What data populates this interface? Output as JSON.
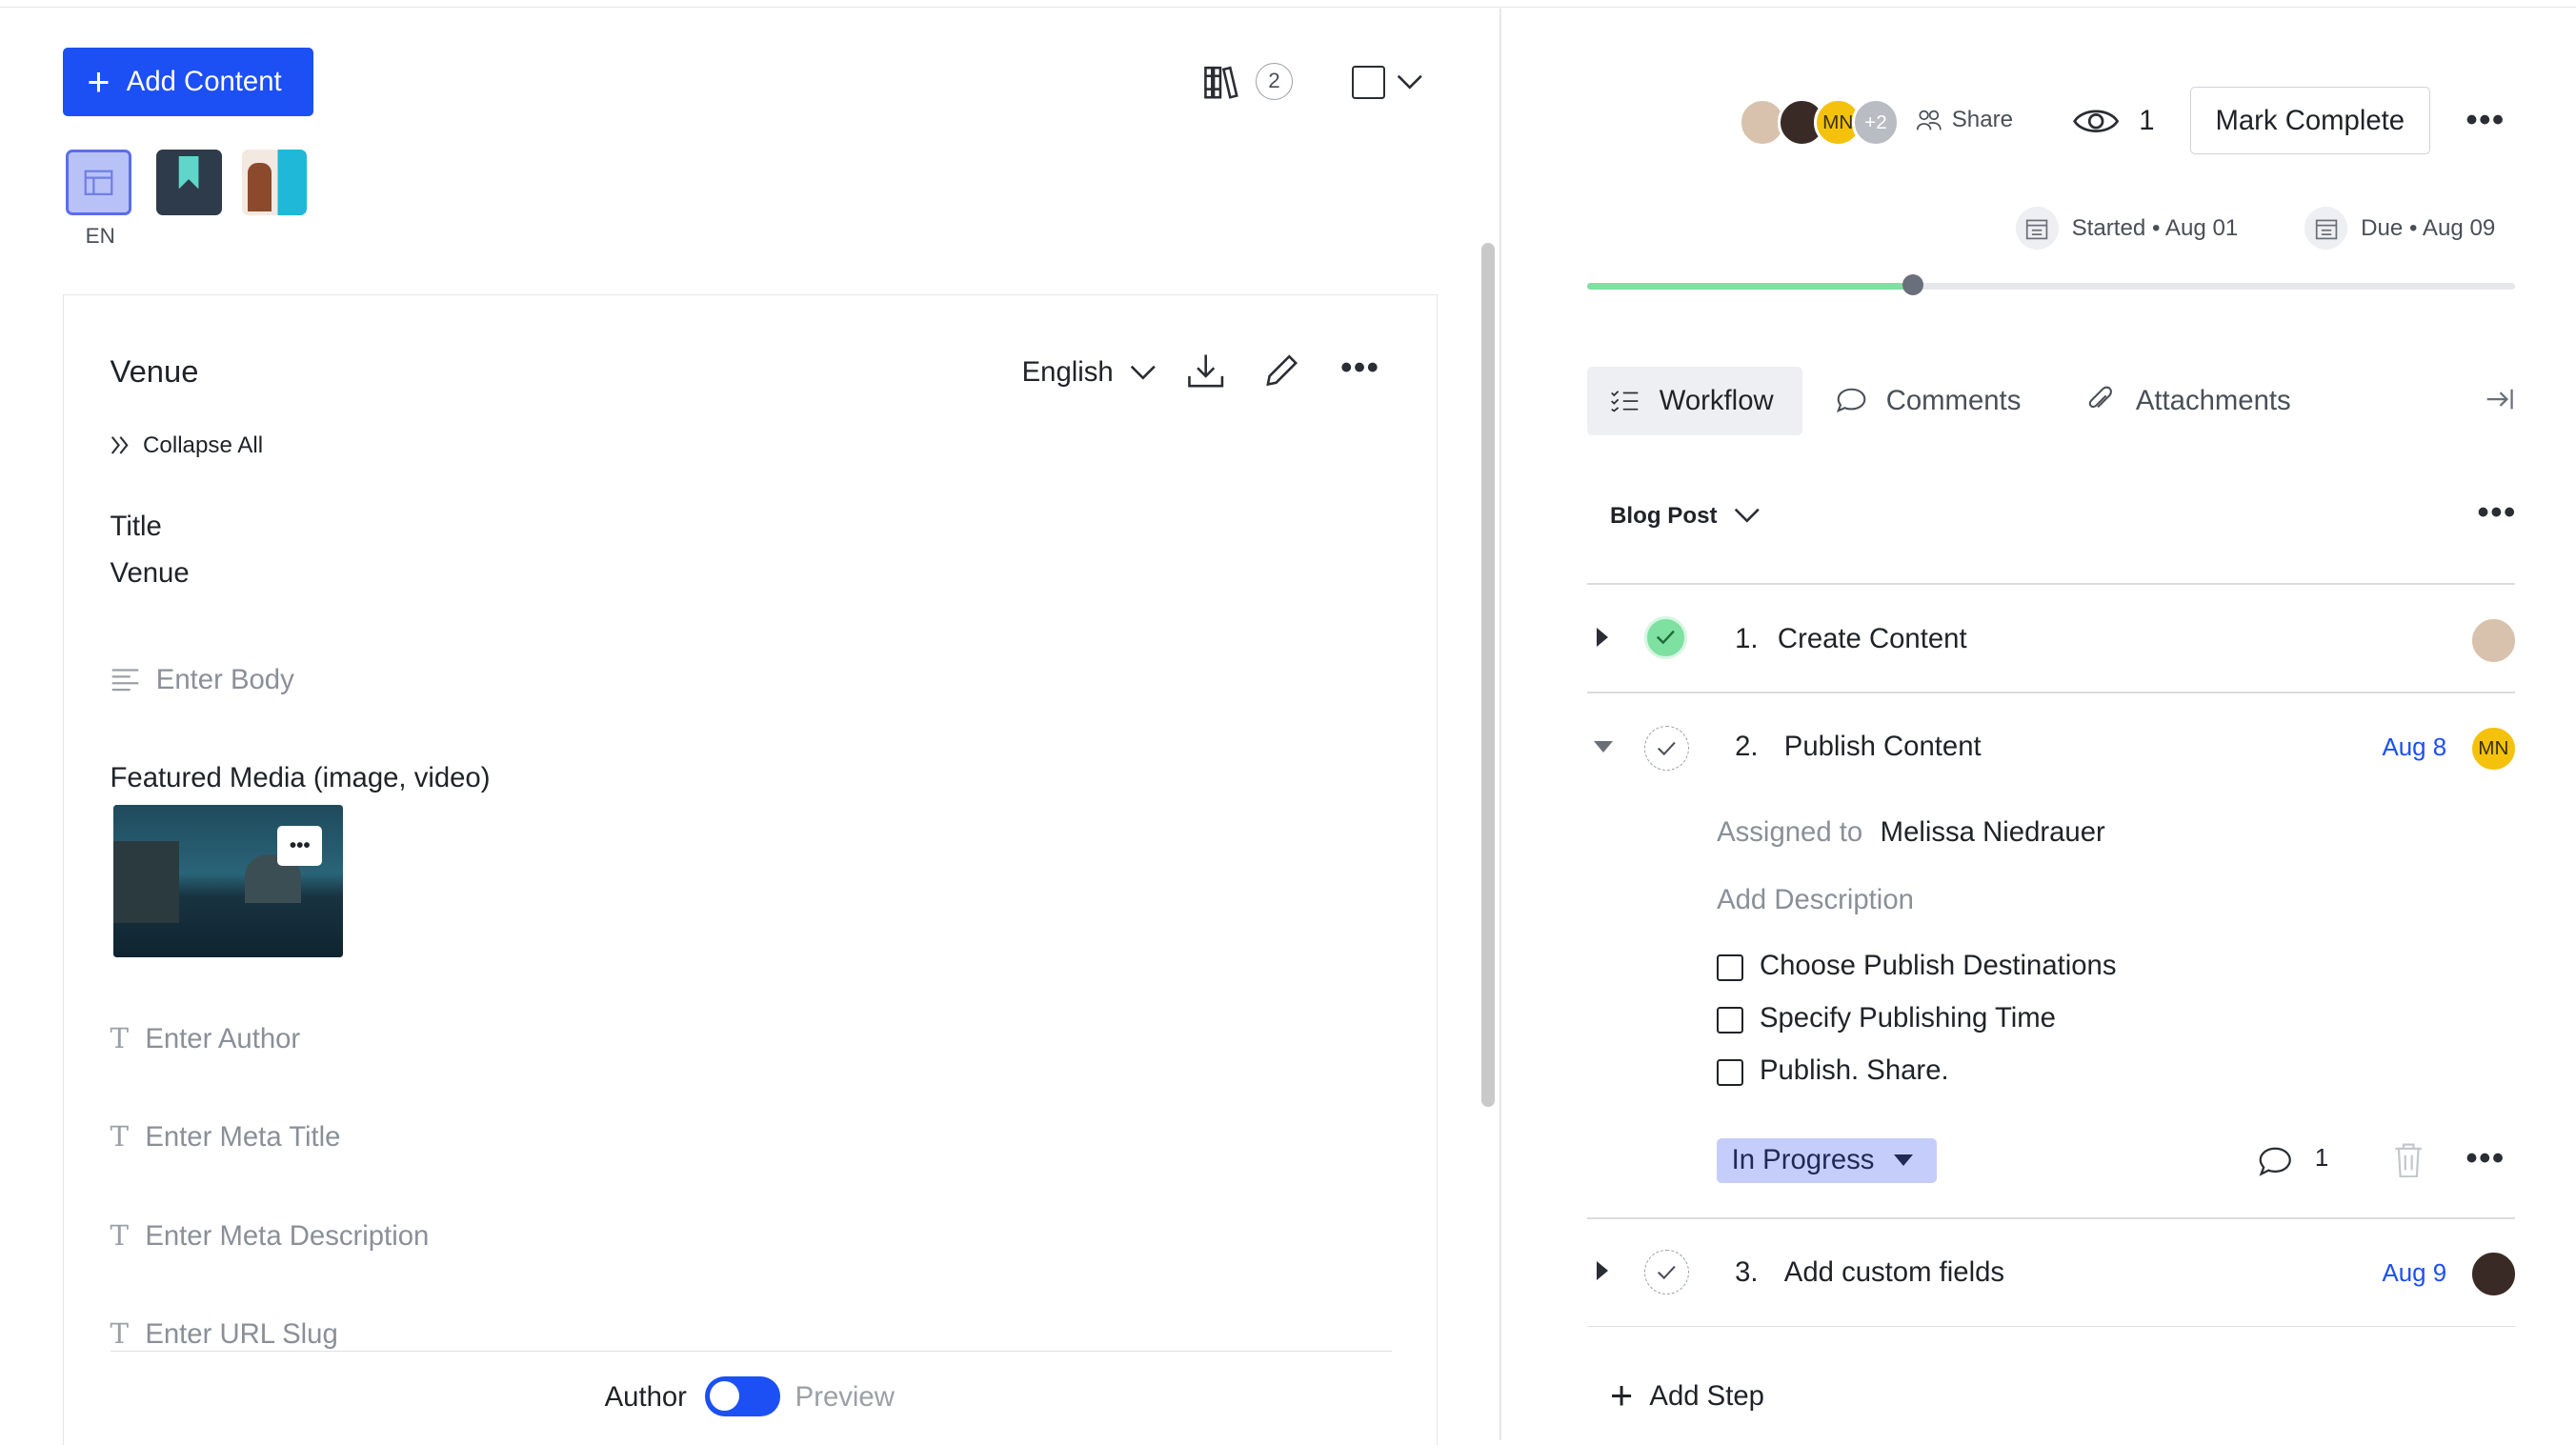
{
  "left": {
    "add_content": "Add Content",
    "library_count": "2",
    "locale": "EN",
    "card": {
      "title": "Venue",
      "language": "English",
      "collapse_all": "Collapse All",
      "field_title_label": "Title",
      "field_title_value": "Venue",
      "body_placeholder": "Enter Body",
      "featured_media_label": "Featured Media (image, video)",
      "author_placeholder": "Enter Author",
      "meta_title_placeholder": "Enter Meta Title",
      "meta_description_placeholder": "Enter Meta Description",
      "url_slug_placeholder": "Enter URL Slug"
    },
    "footer": {
      "author_label": "Author",
      "preview_label": "Preview",
      "toggle_state": "Author"
    }
  },
  "right": {
    "avatars": {
      "initials": "MN",
      "more": "+2"
    },
    "share": "Share",
    "view_count": "1",
    "mark_complete": "Mark Complete",
    "started": "Started • Aug 01",
    "due": "Due • Aug 09",
    "progress": 0.35,
    "tabs": {
      "workflow": "Workflow",
      "comments": "Comments",
      "attachments": "Attachments"
    },
    "template": "Blog Post",
    "steps": [
      {
        "num": "1.",
        "title": "Create Content",
        "date": "",
        "done": true
      },
      {
        "num": "2.",
        "title": "Publish Content",
        "date": "Aug 8",
        "assignee_initials": "MN",
        "done": false
      },
      {
        "num": "3.",
        "title": "Add custom fields",
        "date": "Aug 9",
        "done": false
      }
    ],
    "step2": {
      "assigned_label": "Assigned to",
      "assignee": "Melissa Niedrauer",
      "add_description": "Add Description",
      "checklist": [
        "Choose Publish Destinations",
        "Specify Publishing Time",
        "Publish. Share."
      ],
      "status": "In Progress",
      "comment_count": "1"
    },
    "add_step": "Add Step"
  },
  "colors": {
    "accent": "#1c4ff4",
    "progress": "#7ee0a1",
    "status_bg": "#c5cdfa",
    "done_check": "#7ee0a1"
  }
}
